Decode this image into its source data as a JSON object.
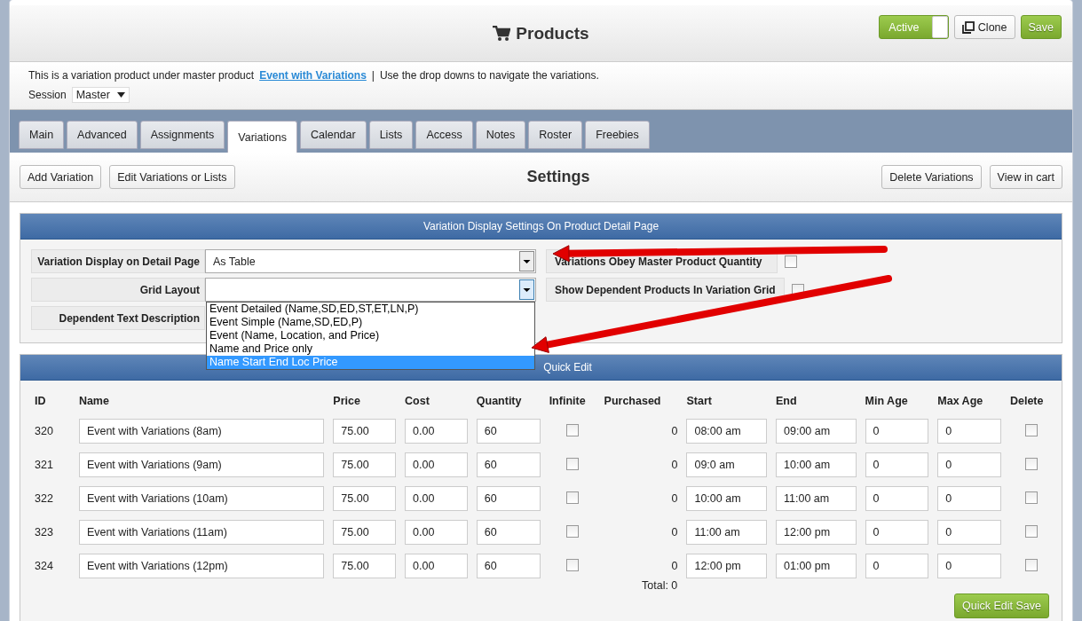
{
  "header": {
    "title": "Products",
    "active_toggle": {
      "label": "Active",
      "on": true
    },
    "clone_button": "Clone",
    "save_button": "Save"
  },
  "info": {
    "text_before": "This is a variation product under master product",
    "link": "Event with Variations",
    "separator": "|",
    "text_after": "Use the drop downs to navigate the variations."
  },
  "session": {
    "label": "Session",
    "value": "Master"
  },
  "tabs": [
    {
      "label": "Main",
      "selected": false
    },
    {
      "label": "Advanced",
      "selected": false
    },
    {
      "label": "Assignments",
      "selected": false
    },
    {
      "label": "Variations",
      "selected": true
    },
    {
      "label": "Calendar",
      "selected": false
    },
    {
      "label": "Lists",
      "selected": false
    },
    {
      "label": "Access",
      "selected": false
    },
    {
      "label": "Notes",
      "selected": false
    },
    {
      "label": "Roster",
      "selected": false
    },
    {
      "label": "Freebies",
      "selected": false
    }
  ],
  "toolbar": {
    "left_buttons": [
      "Add Variation",
      "Edit Variations or Lists"
    ],
    "title": "Settings",
    "right_buttons": [
      "Delete Variations",
      "View in cart"
    ]
  },
  "settings_panel": {
    "title": "Variation Display Settings On Product Detail Page",
    "fields": [
      {
        "kind": "select",
        "label": "Variation Display on Detail Page",
        "value": "As Table",
        "expanded": false
      },
      {
        "kind": "select",
        "label": "Grid Layout",
        "expanded": true,
        "options": [
          {
            "label": "Event Detailed (Name,SD,ED,ST,ET,LN,P)",
            "selected": false
          },
          {
            "label": "Event Simple (Name,SD,ED,P)",
            "selected": false
          },
          {
            "label": "Event (Name, Location, and Price)",
            "selected": false
          },
          {
            "label": "Name and Price only",
            "selected": false
          },
          {
            "label": "Name Start End Loc Price",
            "selected": true
          }
        ]
      },
      {
        "kind": "text",
        "label": "Dependent Text Description"
      }
    ],
    "checks": [
      {
        "label": "Variations Obey Master Product Quantity",
        "checked": false
      },
      {
        "label": "Show Dependent Products In Variation Grid",
        "checked": false
      }
    ]
  },
  "quick_edit": {
    "title": "Quick Edit",
    "columns": [
      "ID",
      "Name",
      "Price",
      "Cost",
      "Quantity",
      "Infinite",
      "Purchased",
      "Start",
      "End",
      "Min Age",
      "Max Age",
      "Delete"
    ],
    "rows": [
      {
        "id": "320",
        "name": "Event with Variations (8am)",
        "price": "75.00",
        "cost": "0.00",
        "quantity": "60",
        "infinite": false,
        "purchased": "0",
        "start": "08:00 am",
        "end": "09:00 am",
        "min_age": "0",
        "max_age": "0",
        "delete": false
      },
      {
        "id": "321",
        "name": "Event with Variations (9am)",
        "price": "75.00",
        "cost": "0.00",
        "quantity": "60",
        "infinite": false,
        "purchased": "0",
        "start": "09:0 am",
        "end": "10:00 am",
        "min_age": "0",
        "max_age": "0",
        "delete": false
      },
      {
        "id": "322",
        "name": "Event with Variations (10am)",
        "price": "75.00",
        "cost": "0.00",
        "quantity": "60",
        "infinite": false,
        "purchased": "0",
        "start": "10:00 am",
        "end": "11:00 am",
        "min_age": "0",
        "max_age": "0",
        "delete": false
      },
      {
        "id": "323",
        "name": "Event with Variations (11am)",
        "price": "75.00",
        "cost": "0.00",
        "quantity": "60",
        "infinite": false,
        "purchased": "0",
        "start": "11:00 am",
        "end": "12:00 pm",
        "min_age": "0",
        "max_age": "0",
        "delete": false
      },
      {
        "id": "324",
        "name": "Event with Variations (12pm)",
        "price": "75.00",
        "cost": "0.00",
        "quantity": "60",
        "infinite": false,
        "purchased": "0",
        "start": "12:00 pm",
        "end": "01:00 pm",
        "min_age": "0",
        "max_age": "0",
        "delete": false
      }
    ],
    "total": "Total: 0",
    "save_button": "Quick Edit Save"
  }
}
